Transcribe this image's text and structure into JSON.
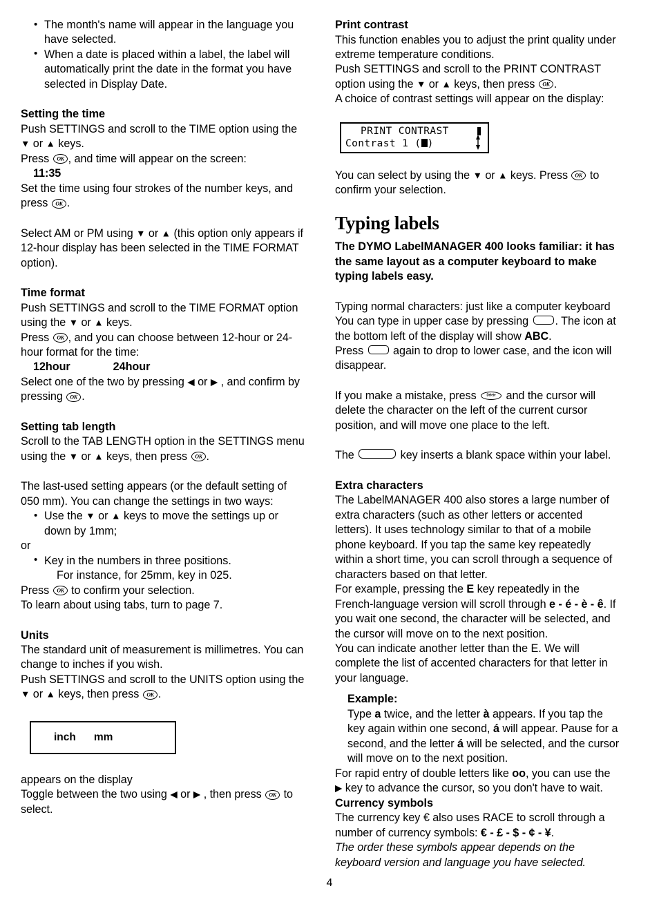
{
  "document": {
    "page_number": "4"
  },
  "left_column": {
    "intro_bullets": [
      "The month's name will appear in the language you have selected.",
      "When a date is placed within a label, the label will automatically print the date in the format you have selected in Display Date."
    ],
    "setting_the_time": {
      "heading": "Setting the time",
      "line1_a": "Push SETTINGS and scroll to the TIME option using the",
      "line1_b": "or",
      "line1_c": "keys.",
      "line2_a": "Press",
      "line2_b": ", and time will appear on the screen:",
      "time_value": "11:35",
      "line3": "Set the time using four strokes of the number keys, and",
      "line4_a": "press",
      "line4_b": ".",
      "ampm_a": "Select AM or PM using",
      "ampm_b": "or",
      "ampm_c": "(this option only appears if 12-hour display has been selected in the TIME FORMAT option)."
    },
    "time_format": {
      "heading": "Time format",
      "line1_a": "Push SETTINGS and scroll to the TIME FORMAT option using the",
      "line1_b": "or",
      "line1_c": "keys.",
      "line2_a": "Press",
      "line2_b": ", and you can choose between 12-hour or 24-hour format for the time:",
      "option_12": "12hour",
      "option_24": "24hour",
      "line3_a": "Select one of the two by pressing",
      "line3_b": "or",
      "line3_c": ", and confirm by pressing",
      "line3_d": "."
    },
    "setting_tab_length": {
      "heading": "Setting tab length",
      "line1_a": "Scroll to the TAB LENGTH option in the SETTINGS menu using the",
      "line1_b": "or",
      "line1_c": "keys, then press",
      "line1_d": ".",
      "line2": "The last-used setting appears (or the default setting of 050 mm). You can change the settings in two ways:",
      "bullet1_a": "Use the",
      "bullet1_b": "or",
      "bullet1_c": "keys to move the settings up or down by 1mm;",
      "or_text": "or",
      "bullet2": "Key in the numbers in three positions.",
      "bullet2_sub": "For instance, for 25mm, key in 025.",
      "line3_a": "Press",
      "line3_b": "to confirm your selection.",
      "line4": "To learn about using tabs, turn to page 7."
    },
    "units": {
      "heading": "Units",
      "line1": "The standard unit of measurement is millimetres. You can change to inches if you wish.",
      "line2_a": "Push SETTINGS and scroll to the UNITS option using the",
      "line2_b": "or",
      "line2_c": "keys, then press",
      "line2_d": ".",
      "box_option_1": "inch",
      "box_option_2": "mm",
      "line3": "appears on the display",
      "line4_a": "Toggle between the two using",
      "line4_b": "or",
      "line4_c": ", then press",
      "line4_d": "to select."
    }
  },
  "right_column": {
    "print_contrast": {
      "heading": "Print contrast",
      "line1": "This function enables you to adjust the print quality under extreme temperature conditions.",
      "line2_a": "Push SETTINGS and scroll to the PRINT CONTRAST option using the",
      "line2_b": "or",
      "line2_c": "keys, then press",
      "line2_d": ".",
      "line3": "A choice of contrast settings will appear on the display:",
      "lcd_line1": "PRINT CONTRAST",
      "lcd_line2_prefix": "Contrast 1 (",
      "lcd_line2_suffix": ")",
      "line4_a": "You can select by using the",
      "line4_b": "or",
      "line4_c": "keys. Press",
      "line4_d": "to confirm your selection."
    },
    "typing_labels": {
      "heading": "Typing labels",
      "intro": "The DYMO LabelMANAGER 400 looks familiar: it has the same layout as a computer keyboard to make typing labels easy.",
      "p1_line1": "Typing normal characters: just like a computer keyboard",
      "p1_line2_a": "You can type in upper case by pressing",
      "p1_line2_b": ". The icon at the bottom left of the display will show",
      "p1_abc": "ABC",
      "p1_line2_c": ".",
      "p1_line3_a": "Press",
      "p1_line3_b": "again to drop to lower case, and the icon will disappear.",
      "p2_a": "If you make a mistake, press",
      "p2_b": "and the cursor will delete the character on the left of the current cursor position, and will move one place to the left.",
      "p3_a": "The",
      "p3_b": "key inserts a blank space within your label."
    },
    "extra_characters": {
      "heading": "Extra characters",
      "p1": "The LabelMANAGER 400 also stores a large number of extra characters (such as other letters or accented letters). It uses technology similar to that of a mobile phone keyboard. If you tap the same key repeatedly within a short time, you can scroll through a sequence of characters based on that letter.",
      "p2_a": "For example, pressing the",
      "p2_e": "E",
      "p2_b": "key repeatedly in the French-language version will scroll through",
      "p2_seq": "e - é - è - ê",
      "p2_c": ". If you wait one second, the character will be selected, and the cursor will move on to the next position.",
      "p3": "You can indicate another letter than the E. We will complete the list of accented characters for that letter in your language.",
      "example_heading": "Example:",
      "example_a": "Type",
      "example_a_key": "a",
      "example_b": "twice, and the letter",
      "example_agrave": "à",
      "example_c": "appears. If you tap the key again within one second,",
      "example_aacute1": "á",
      "example_d": "will appear. Pause for a second, and the letter",
      "example_aacute2": "á",
      "example_e": "will be selected, and the cursor will move on to the next position.",
      "p4_a": "For rapid entry of double letters like",
      "p4_oo": "oo",
      "p4_b": ", you can use the",
      "p4_c": "key to advance the cursor, so you don't have to wait."
    },
    "currency_symbols": {
      "heading": "Currency symbols",
      "line1_a": "The currency key",
      "euro": "€",
      "line1_b": "also uses RACE to scroll through a number of currency symbols:",
      "symbols": "€ - £ - $ - ¢ - ¥",
      "line1_c": ".",
      "note": "The order these symbols appear depends on the keyboard version and language you have selected."
    }
  },
  "icons": {
    "down_arrow": "▼",
    "up_arrow": "▲",
    "left_arrow": "◀",
    "right_arrow": "▶",
    "ok_key": "ok-key-icon",
    "caps_key": "caps-lock-key-icon",
    "space_key": "space-bar-key-icon",
    "delete_key": "delete-key-icon"
  },
  "colors": {
    "text": "#000000",
    "background": "#ffffff"
  }
}
